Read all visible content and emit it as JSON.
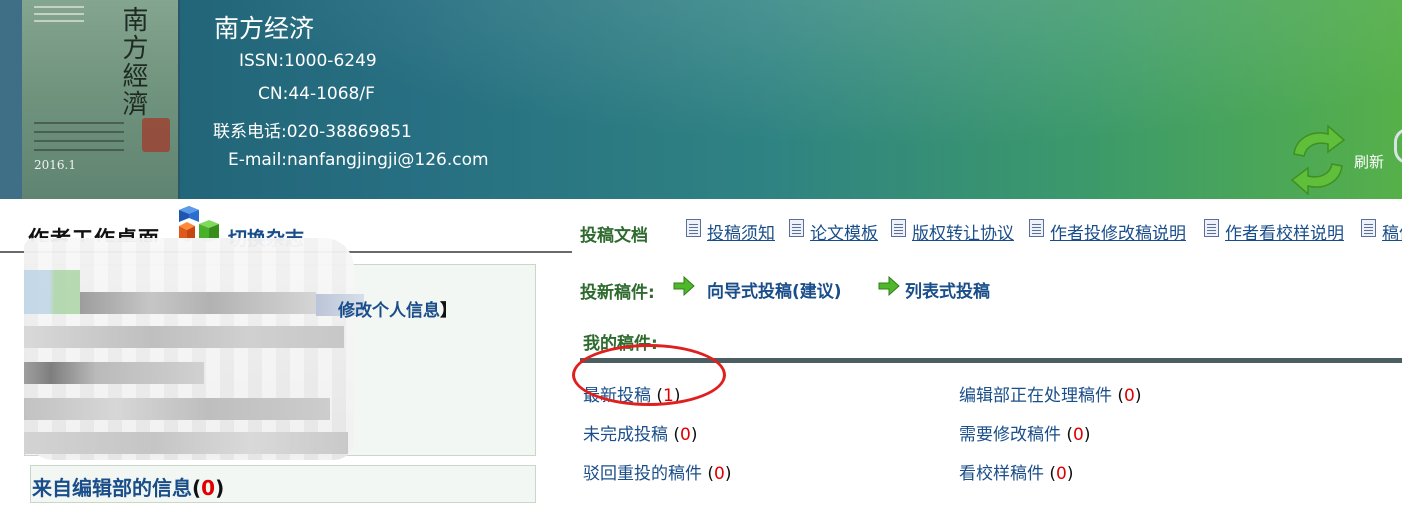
{
  "header": {
    "journal_name": "南方经济",
    "issn": "ISSN:1000-6249",
    "cn": "CN:44-1068/F",
    "phone": "联系电话:020-38869851",
    "email": "E-mail:nanfangjingji@126.com",
    "cover": {
      "title": "南方經濟",
      "year": "2016.1"
    },
    "refresh_label": "刷新"
  },
  "left_panel": {
    "desk_title": "作者工作桌面",
    "switch_journal": "切换杂志",
    "edit_info": "修改个人信息",
    "messages_label": "来自编辑部的信息",
    "messages_count": "0"
  },
  "right_panel": {
    "docs_label": "投稿文档",
    "docs": [
      "投稿须知",
      "论文模板",
      "版权转让协议",
      "作者投修改稿说明",
      "作者看校样说明",
      "稿件"
    ],
    "new_submission_label": "投新稿件:",
    "wizard_submission": "向导式投稿(建议)",
    "list_submission": "列表式投稿",
    "my_manuscripts_label": "我的稿件:",
    "items": [
      {
        "label": "最新投稿",
        "count": "1"
      },
      {
        "label": "编辑部正在处理稿件",
        "count": "0"
      },
      {
        "label": "未完成投稿",
        "count": "0"
      },
      {
        "label": "需要修改稿件",
        "count": "0"
      },
      {
        "label": "驳回重投的稿件",
        "count": "0"
      },
      {
        "label": "看校样稿件",
        "count": "0"
      }
    ]
  },
  "colors": {
    "link_blue": "#1a4e8a",
    "section_green": "#2f6b2f",
    "count_red": "#e00000",
    "annotation_red": "#e01f1f"
  }
}
